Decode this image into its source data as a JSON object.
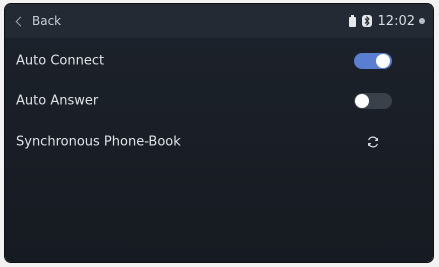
{
  "header": {
    "back_label": "Back",
    "time": "12:02",
    "icons": [
      "chevron-left-icon",
      "battery-icon",
      "bluetooth-icon",
      "status-dot-icon"
    ]
  },
  "settings": {
    "rows": [
      {
        "label": "Auto Connect",
        "control": "toggle",
        "value": "on"
      },
      {
        "label": "Auto Answer",
        "control": "toggle",
        "value": "off"
      },
      {
        "label": "Synchronous Phone-Book",
        "control": "button",
        "icon": "sync-icon"
      }
    ]
  },
  "colors": {
    "toggle_on": "#5a7fd0",
    "toggle_off": "#3b414a",
    "background": "#1a1f27",
    "header": "#242a33"
  }
}
